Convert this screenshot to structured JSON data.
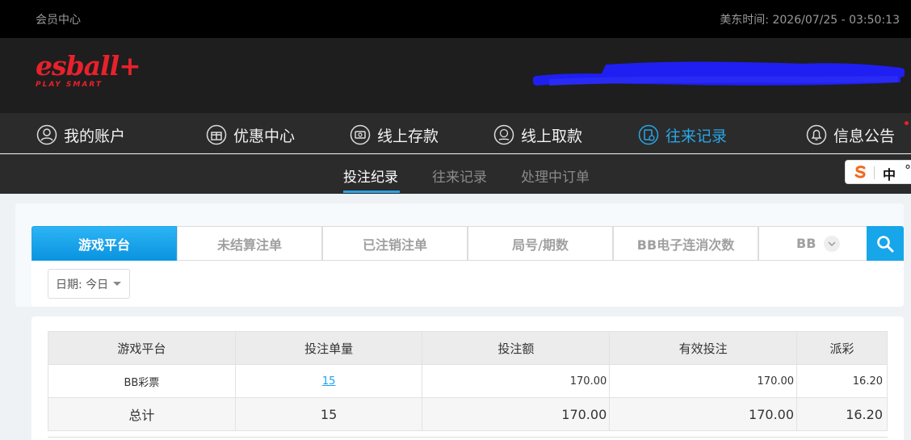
{
  "topbar": {
    "member_center": "会员中心",
    "time_label": "美东时间: 2026/07/25 - 03:50:13"
  },
  "logo": {
    "brand": "esball+",
    "tagline": "PLAY SMART"
  },
  "mainnav": [
    {
      "label": "我的账户",
      "icon": "user-icon"
    },
    {
      "label": "优惠中心",
      "icon": "gift-icon"
    },
    {
      "label": "线上存款",
      "icon": "deposit-icon"
    },
    {
      "label": "线上取款",
      "icon": "withdraw-icon"
    },
    {
      "label": "往来记录",
      "icon": "records-icon",
      "active": true
    },
    {
      "label": "信息公告",
      "icon": "bell-icon"
    }
  ],
  "subnav": [
    {
      "label": "投注纪录",
      "active": true
    },
    {
      "label": "往来记录"
    },
    {
      "label": "处理中订单"
    }
  ],
  "ime": {
    "zh": "中",
    "deg": "°"
  },
  "tabs": [
    "游戏平台",
    "未结算注单",
    "已注销注单",
    "局号/期数",
    "BB电子连消次数",
    "BB"
  ],
  "filter": {
    "date_label": "日期: 今日"
  },
  "table": {
    "headers": [
      "游戏平台",
      "投注单量",
      "投注额",
      "有效投注",
      "派彩"
    ],
    "rows": [
      {
        "platform": "BB彩票",
        "count": "15",
        "amount": "170.00",
        "valid": "170.00",
        "payout": "16.20"
      }
    ],
    "total": {
      "label": "总计",
      "count": "15",
      "amount": "170.00",
      "valid": "170.00",
      "payout": "16.20"
    }
  },
  "colors": {
    "accent": "#1aa3ea",
    "brand": "#e8212b"
  }
}
